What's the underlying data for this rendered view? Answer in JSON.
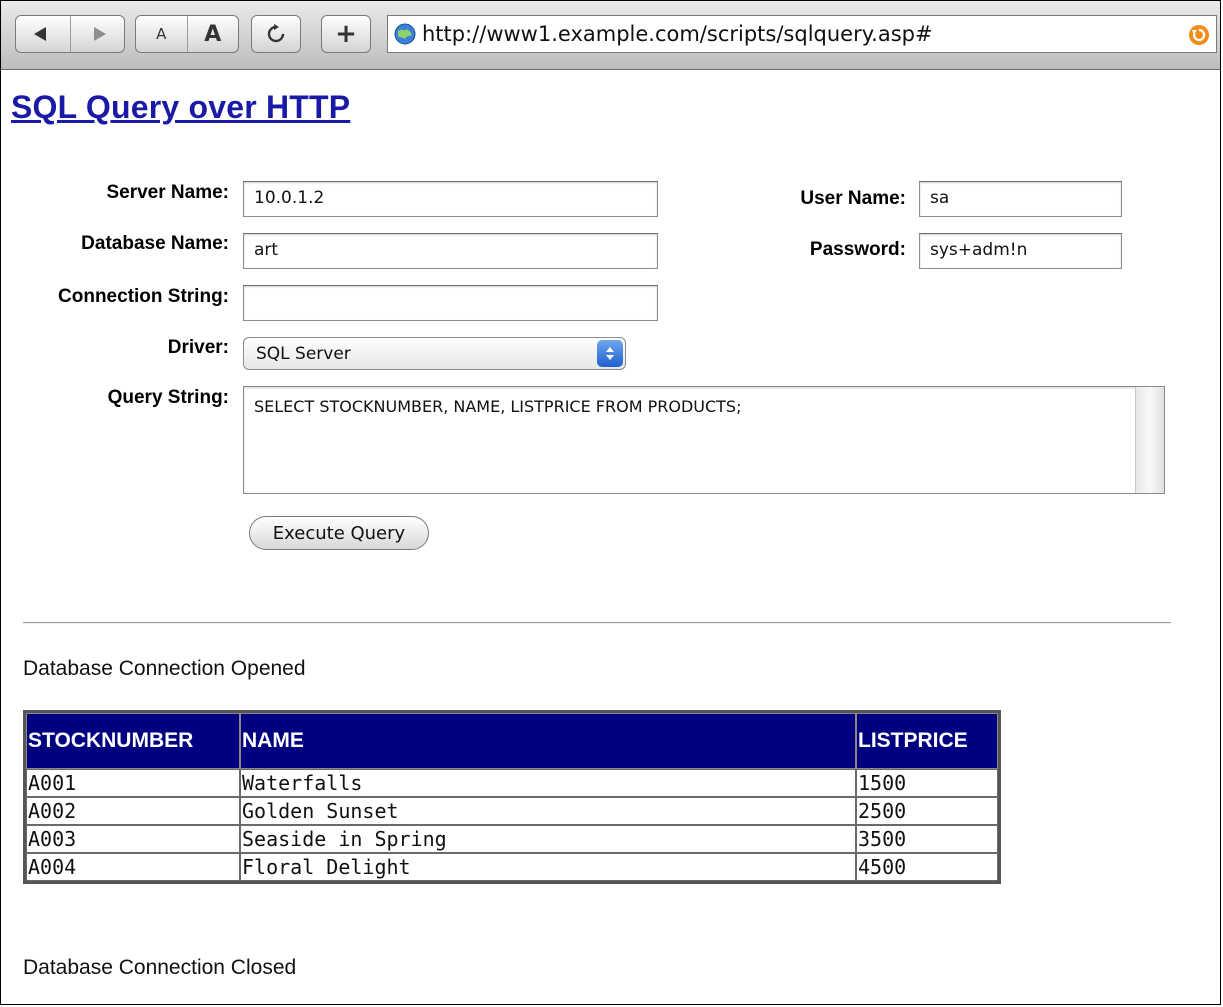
{
  "browser": {
    "url": "http://www1.example.com/scripts/sqlquery.asp#",
    "font_smaller_label": "A",
    "font_larger_label": "A",
    "add_label": "+"
  },
  "page": {
    "title": "SQL Query over HTTP"
  },
  "form": {
    "server_name_label": "Server Name:",
    "server_name_value": "10.0.1.2",
    "database_name_label": "Database Name:",
    "database_name_value": "art",
    "connection_string_label": "Connection String:",
    "connection_string_value": "",
    "driver_label": "Driver:",
    "driver_value": "SQL Server",
    "query_string_label": "Query String:",
    "query_string_value": "SELECT STOCKNUMBER, NAME, LISTPRICE FROM PRODUCTS;",
    "user_name_label": "User Name:",
    "user_name_value": "sa",
    "password_label": "Password:",
    "password_value": "sys+adm!n",
    "execute_button_label": "Execute Query"
  },
  "results": {
    "opened_message": "Database Connection Opened",
    "closed_message": "Database Connection Closed",
    "columns": [
      "STOCKNUMBER",
      "NAME",
      "LISTPRICE"
    ],
    "rows": [
      [
        "A001",
        "Waterfalls",
        "1500"
      ],
      [
        "A002",
        "Golden Sunset",
        "2500"
      ],
      [
        "A003",
        "Seaside in Spring",
        "3500"
      ],
      [
        "A004",
        "Floral Delight",
        "4500"
      ]
    ]
  },
  "icons": {
    "back": "back-arrow-icon",
    "forward": "forward-arrow-icon",
    "reload": "reload-icon",
    "add": "plus-icon",
    "site": "globe-icon",
    "snapback": "snapback-icon"
  },
  "colors": {
    "title_link": "#1a1aa6",
    "table_header_bg": "#000080",
    "table_header_text": "#ffffff",
    "select_arrows": "#1f5fd0",
    "snapback": "#f28c1a"
  }
}
